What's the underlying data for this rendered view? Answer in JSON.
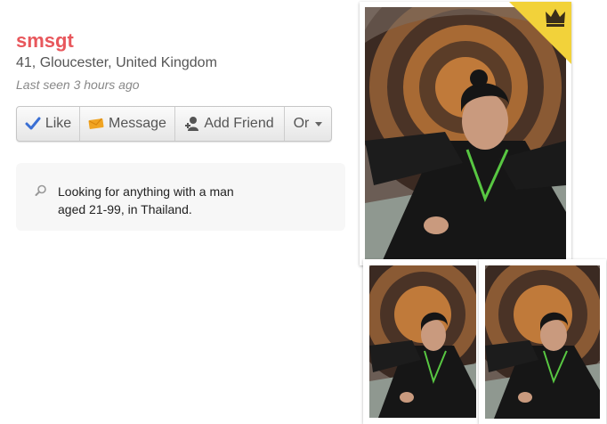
{
  "profile": {
    "username": "smsgt",
    "location": "41, Gloucester, United Kingdom",
    "last_seen": "Last seen 3 hours ago"
  },
  "actions": {
    "like_label": "Like",
    "message_label": "Message",
    "add_friend_label": "Add Friend",
    "more_label": "Or"
  },
  "looking_for": {
    "text": "Looking for anything with a man aged 21-99, in Thailand."
  },
  "photos": {
    "main_icon": "profile-photo",
    "thumbnail_icons": [
      "profile-photo-thumbnail",
      "profile-photo-thumbnail"
    ],
    "premium_icon": "crown-icon"
  },
  "colors": {
    "username": "#e8575c",
    "premium_badge": "#f2d23a",
    "like_icon": "#3a6fd4",
    "message_icon": "#f0a422"
  }
}
